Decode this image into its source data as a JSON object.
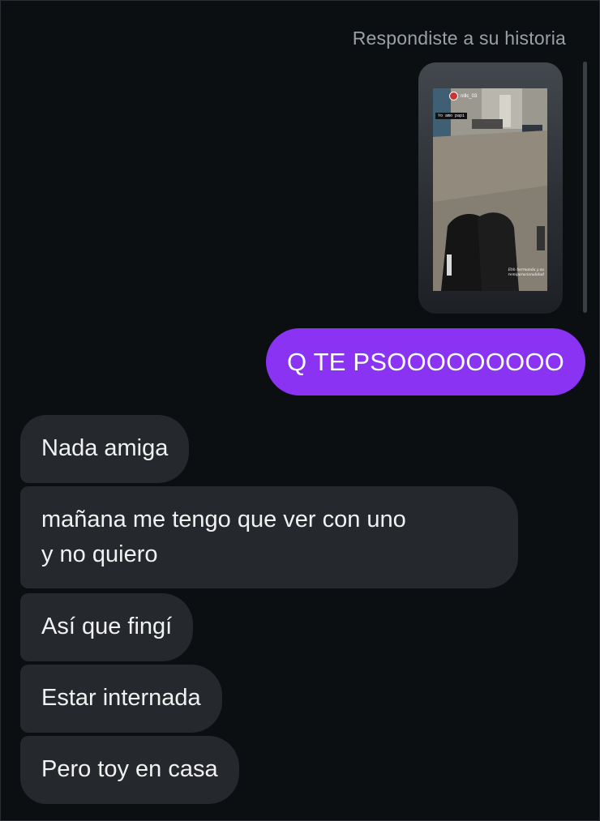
{
  "reply_caption": "Respondiste a su historia",
  "story": {
    "username": "nillc_03",
    "sticker_text": "Yo amo papi",
    "caption_text": "Ehh hermanda y su remiparacionalidad"
  },
  "messages": {
    "outgoing": [
      {
        "text": "Q TE PSOOOOOOOOO"
      }
    ],
    "incoming": [
      {
        "text": "Nada amiga"
      },
      {
        "text": "mañana me tengo que ver con uno\ny no quiero"
      },
      {
        "text": "Así que fingí"
      },
      {
        "text": "Estar internada"
      },
      {
        "text": "Pero toy en casa"
      }
    ]
  },
  "colors": {
    "background": "#0b0f12",
    "outgoing_bubble": "#8a33f3",
    "incoming_bubble": "#25282d",
    "caption_text": "#9aa0a6"
  }
}
